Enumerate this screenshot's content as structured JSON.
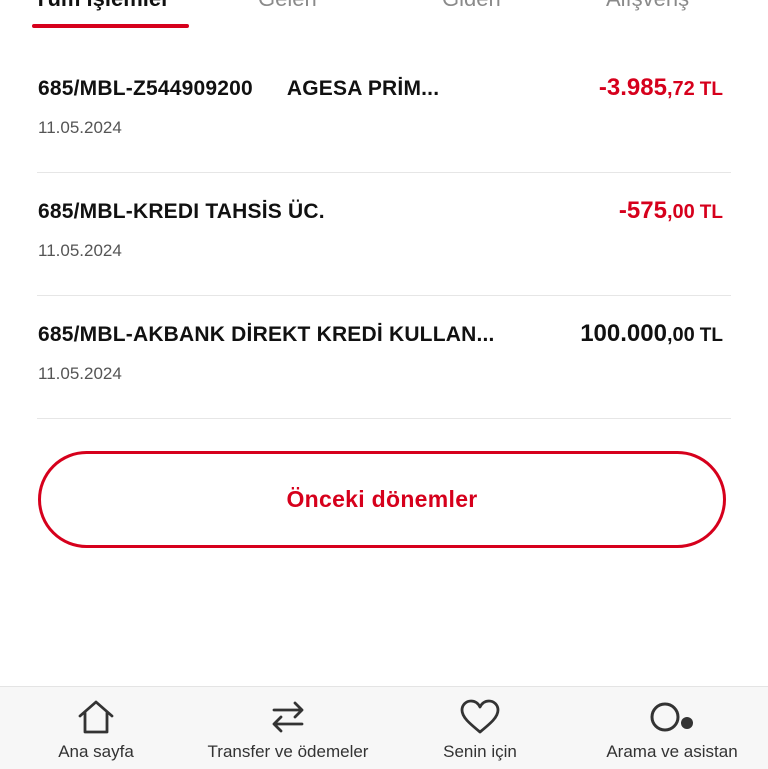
{
  "tabs": [
    {
      "label": "Tüm işlemler"
    },
    {
      "label": "Gelen"
    },
    {
      "label": "Giden"
    },
    {
      "label": "Alışveriş"
    }
  ],
  "transactions": [
    {
      "ref": "685/MBL-Z544909200",
      "desc": "AGESA PRİM...",
      "date": "11.05.2024",
      "amount_int": "-3.985",
      "amount_dec": ",72",
      "currency": "TL",
      "sign": "negative"
    },
    {
      "ref": "685/MBL-KREDI TAHSİS ÜC.",
      "desc": "",
      "date": "11.05.2024",
      "amount_int": "-575",
      "amount_dec": ",00",
      "currency": "TL",
      "sign": "negative"
    },
    {
      "ref": "685/MBL-AKBANK DİREKT KREDİ KULLAN...",
      "desc": "",
      "date": "11.05.2024",
      "amount_int": "100.000",
      "amount_dec": ",00",
      "currency": "TL",
      "sign": "positive"
    }
  ],
  "previous_periods_button": "Önceki dönemler",
  "bottom_nav": [
    {
      "label": "Ana sayfa",
      "icon": "home-icon"
    },
    {
      "label": "Transfer ve ödemeler",
      "icon": "transfer-icon"
    },
    {
      "label": "Senin için",
      "icon": "heart-icon"
    },
    {
      "label": "Arama ve asistan",
      "icon": "search-assistant-icon"
    }
  ],
  "colors": {
    "accent": "#d6001c",
    "text": "#111111",
    "muted": "#555555"
  }
}
